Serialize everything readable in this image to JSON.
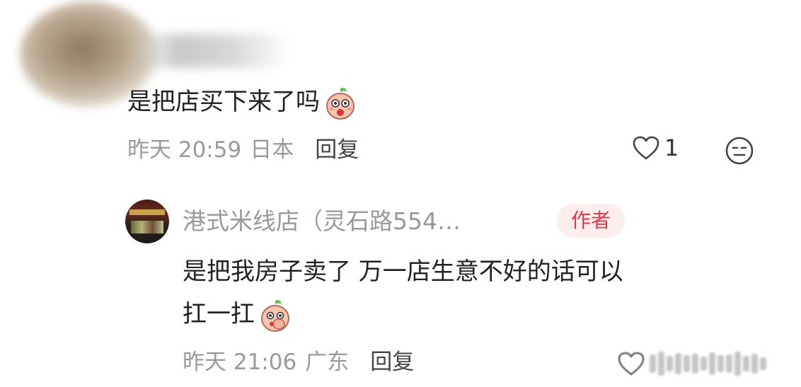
{
  "comment": {
    "text": "是把店买下来了吗",
    "emoji": "peach-surprised-emoji",
    "time": "昨天 20:59",
    "location": "日本",
    "reply_label": "回复",
    "like_count": "1"
  },
  "reply": {
    "author": "港式米线店（灵石路554…",
    "badge": "作者",
    "line1": "是把我房子卖了 万一店生意不好的话可以",
    "line2": "扛一扛",
    "emoji": "peach-shy-emoji",
    "time": "昨天 21:06",
    "location": "广东",
    "reply_label": "回复"
  },
  "colors": {
    "badge_text": "#e5354a",
    "badge_bg": "#fdeeee",
    "meta": "#9a9a9a"
  }
}
